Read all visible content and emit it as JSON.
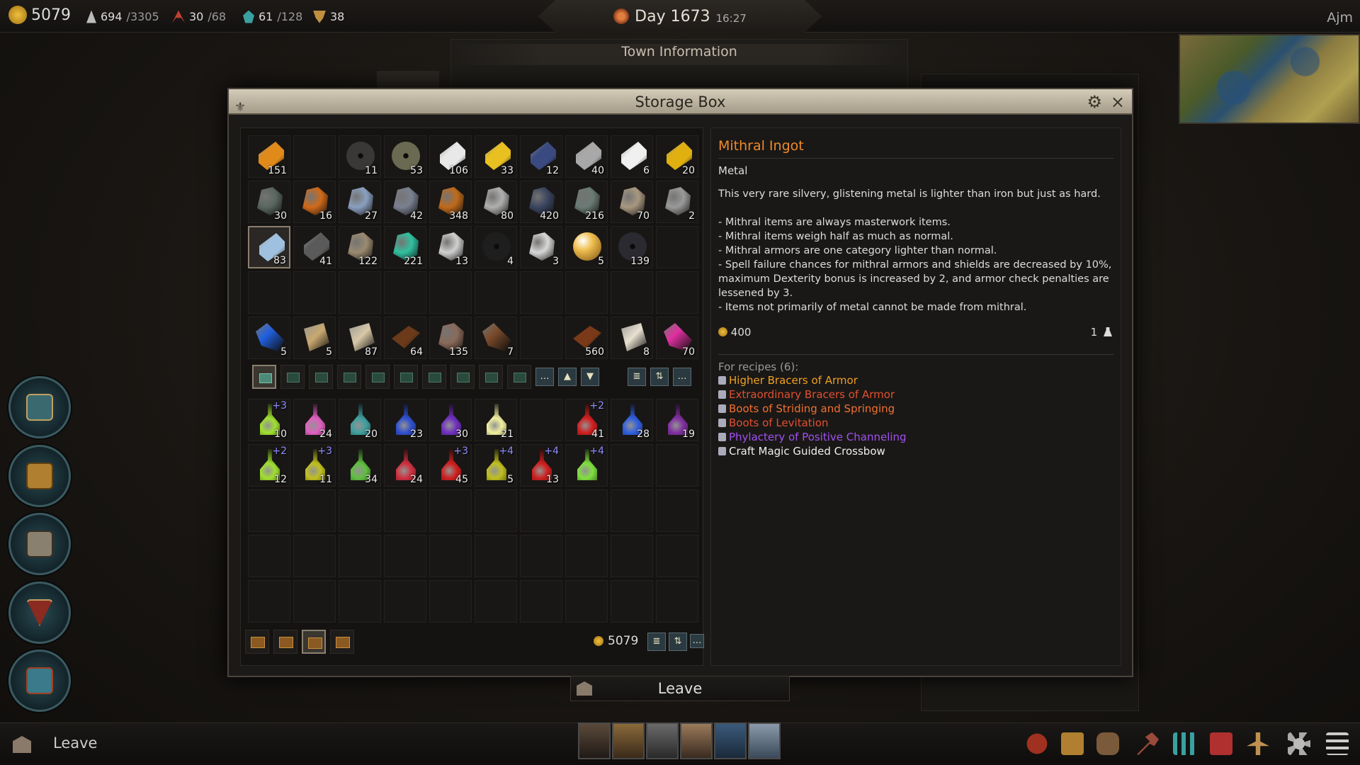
{
  "topbar": {
    "gold": "5079",
    "population": "694",
    "population_max": "/3305",
    "units": "30",
    "units_max": "/68",
    "items": "61",
    "items_max": "/128",
    "misc": "38",
    "day": "Day 1673",
    "time": "16:27",
    "player": "Ajm"
  },
  "background": {
    "town_title": "Town Information"
  },
  "window": {
    "title": "Storage Box",
    "close_icon": "×",
    "gear_icon": "⚙",
    "logo_icon": "⚜"
  },
  "materials": [
    {
      "qty": "151",
      "color": "#e08a1a",
      "shape": "ingot",
      "icon": "bronze-ingot-icon"
    },
    {
      "qty": "",
      "color": "",
      "shape": "empty",
      "icon": ""
    },
    {
      "qty": "11",
      "color": "#3a3836",
      "shape": "disc",
      "icon": "dark-disc-icon"
    },
    {
      "qty": "53",
      "color": "#6a6a52",
      "shape": "disc",
      "icon": "grinding-stone-icon"
    },
    {
      "qty": "106",
      "color": "#e8e8e8",
      "shape": "ingot",
      "icon": "silver-ingot-icon"
    },
    {
      "qty": "33",
      "color": "#e8c020",
      "shape": "ingot",
      "icon": "gold-ingot-icon"
    },
    {
      "qty": "12",
      "color": "#3a4a80",
      "shape": "ingot",
      "icon": "blue-ingot-icon"
    },
    {
      "qty": "40",
      "color": "#a8a8a8",
      "shape": "ingot",
      "icon": "iron-ingot-icon"
    },
    {
      "qty": "6",
      "color": "#f0f0f0",
      "shape": "ingot",
      "icon": "platinum-ingot-icon"
    },
    {
      "qty": "20",
      "color": "#e0b010",
      "shape": "ingot",
      "icon": "gold-bar-icon"
    },
    {
      "qty": "30",
      "color": "#5a6660",
      "shape": "ore",
      "icon": "gray-ore-icon"
    },
    {
      "qty": "16",
      "color": "#d06a1a",
      "shape": "ore",
      "icon": "fire-ore-icon"
    },
    {
      "qty": "27",
      "color": "#8aa0c0",
      "shape": "ore",
      "icon": "crystal-ore-icon"
    },
    {
      "qty": "42",
      "color": "#7a8090",
      "shape": "ore",
      "icon": "iron-ore-icon"
    },
    {
      "qty": "348",
      "color": "#c06a1a",
      "shape": "ore",
      "icon": "copper-ore-icon"
    },
    {
      "qty": "80",
      "color": "#b0b0b0",
      "shape": "ore",
      "icon": "silver-ore-icon"
    },
    {
      "qty": "420",
      "color": "#3a4560",
      "shape": "ore",
      "icon": "dark-ore-icon"
    },
    {
      "qty": "216",
      "color": "#6a7a74",
      "shape": "ore",
      "icon": "stone-ore-icon"
    },
    {
      "qty": "70",
      "color": "#a89880",
      "shape": "ore",
      "icon": "sandstone-icon"
    },
    {
      "qty": "2",
      "color": "#9a9a9a",
      "shape": "ore",
      "icon": "granite-icon"
    },
    {
      "qty": "83",
      "color": "#a0c0e0",
      "shape": "ingot",
      "icon": "mithral-ingot-icon",
      "selected": true
    },
    {
      "qty": "41",
      "color": "#5a5a5a",
      "shape": "ingot",
      "icon": "adamantine-ingot-icon"
    },
    {
      "qty": "122",
      "color": "#9a8a70",
      "shape": "ore",
      "icon": "rock-icon"
    },
    {
      "qty": "221",
      "color": "#30c0a0",
      "shape": "ore",
      "icon": "emerald-ore-icon"
    },
    {
      "qty": "13",
      "color": "#d0d0d0",
      "shape": "ore",
      "icon": "quartz-ore-icon"
    },
    {
      "qty": "4",
      "color": "#1e1e1e",
      "shape": "disc",
      "icon": "black-disc-icon"
    },
    {
      "qty": "3",
      "color": "#d8d8d8",
      "shape": "ore",
      "icon": "salt-ore-icon"
    },
    {
      "qty": "5",
      "color": "#f0c050",
      "shape": "orb",
      "icon": "gold-orb-icon"
    },
    {
      "qty": "139",
      "color": "#2a2a30",
      "shape": "disc",
      "icon": "obsidian-disc-icon"
    },
    {
      "qty": "",
      "color": "",
      "shape": "empty",
      "icon": ""
    },
    {
      "qty": "",
      "color": "",
      "shape": "empty",
      "icon": ""
    },
    {
      "qty": "",
      "color": "",
      "shape": "empty",
      "icon": ""
    },
    {
      "qty": "",
      "color": "",
      "shape": "empty",
      "icon": ""
    },
    {
      "qty": "",
      "color": "",
      "shape": "empty",
      "icon": ""
    },
    {
      "qty": "",
      "color": "",
      "shape": "empty",
      "icon": ""
    },
    {
      "qty": "",
      "color": "",
      "shape": "empty",
      "icon": ""
    },
    {
      "qty": "",
      "color": "",
      "shape": "empty",
      "icon": ""
    },
    {
      "qty": "",
      "color": "",
      "shape": "empty",
      "icon": ""
    },
    {
      "qty": "",
      "color": "",
      "shape": "empty",
      "icon": ""
    },
    {
      "qty": "",
      "color": "",
      "shape": "empty",
      "icon": ""
    },
    {
      "qty": "5",
      "color": "#2060e0",
      "shape": "cloth",
      "icon": "blue-cloth-icon"
    },
    {
      "qty": "5",
      "color": "#c8a870",
      "shape": "scroll",
      "icon": "parchment-roll-icon"
    },
    {
      "qty": "87",
      "color": "#d8c8a8",
      "shape": "scroll",
      "icon": "paper-icon"
    },
    {
      "qty": "64",
      "color": "#6a3a1a",
      "shape": "plank",
      "icon": "wood-plank-icon"
    },
    {
      "qty": "135",
      "color": "#8a6a5a",
      "shape": "ore",
      "icon": "hide-icon"
    },
    {
      "qty": "7",
      "color": "#7a4a2a",
      "shape": "cloth",
      "icon": "leather-icon"
    },
    {
      "qty": "",
      "color": "",
      "shape": "empty",
      "icon": ""
    },
    {
      "qty": "560",
      "color": "#7a3a1a",
      "shape": "plank",
      "icon": "lumber-icon"
    },
    {
      "qty": "8",
      "color": "#e8e0d0",
      "shape": "scroll",
      "icon": "scroll-icon"
    },
    {
      "qty": "70",
      "color": "#e030a0",
      "shape": "cloth",
      "icon": "silk-icon"
    }
  ],
  "tab_bar": {
    "more": "…",
    "up": "▲",
    "down": "▼",
    "stack": "≣",
    "sort": "⇅",
    "options": "…"
  },
  "potions": [
    {
      "qty": "10",
      "plus": "+3",
      "color": "#a0e030"
    },
    {
      "qty": "24",
      "plus": "",
      "color": "#e060c0"
    },
    {
      "qty": "20",
      "plus": "",
      "color": "#40a0a0"
    },
    {
      "qty": "23",
      "plus": "",
      "color": "#3050d0"
    },
    {
      "qty": "30",
      "plus": "",
      "color": "#7030c0"
    },
    {
      "qty": "21",
      "plus": "",
      "color": "#f0f0a0"
    },
    {
      "qty": "",
      "plus": "",
      "color": ""
    },
    {
      "qty": "41",
      "plus": "+2",
      "color": "#d02020"
    },
    {
      "qty": "28",
      "plus": "",
      "color": "#3060e0"
    },
    {
      "qty": "19",
      "plus": "",
      "color": "#8030a0"
    },
    {
      "qty": "12",
      "plus": "+2",
      "color": "#a0e030"
    },
    {
      "qty": "11",
      "plus": "+3",
      "color": "#c0c020"
    },
    {
      "qty": "34",
      "plus": "",
      "color": "#60c040"
    },
    {
      "qty": "24",
      "plus": "",
      "color": "#d03040"
    },
    {
      "qty": "45",
      "plus": "+3",
      "color": "#d02020"
    },
    {
      "qty": "5",
      "plus": "+4",
      "color": "#c0c020"
    },
    {
      "qty": "13",
      "plus": "+4",
      "color": "#d02020"
    },
    {
      "qty": "",
      "plus": "+4",
      "color": "#80e040"
    },
    {
      "qty": "",
      "plus": "",
      "color": ""
    },
    {
      "qty": "",
      "plus": "",
      "color": ""
    }
  ],
  "footer": {
    "gold": "5079"
  },
  "detail": {
    "name": "Mithral Ingot",
    "type": "Metal",
    "desc_intro": "This very rare silvery, glistening metal is lighter than iron but just as hard.",
    "bullets": [
      "- Mithral items are always masterwork items.",
      "- Mithral items weigh half as much as normal.",
      "- Mithral armors are one category lighter than normal.",
      "- Spell failure chances for mithral armors and shields are decreased by 10%, maximum Dexterity bonus is increased by 2, and armor check penalties are lessened by 3.",
      "- Items not primarily of metal cannot be made from mithral."
    ],
    "price": "400",
    "weight": "1",
    "recipes_title": "For recipes (6):",
    "recipes": [
      {
        "name": "Higher Bracers of Armor",
        "color": "#f0a020"
      },
      {
        "name": "Extraordinary Bracers of Armor",
        "color": "#e05030"
      },
      {
        "name": "Boots of Striding and Springing",
        "color": "#f07030"
      },
      {
        "name": "Boots of Levitation",
        "color": "#e05030"
      },
      {
        "name": "Phylactery of Positive Channeling",
        "color": "#a050f0"
      },
      {
        "name": "Craft Magic Guided Crossbow",
        "color": "#eeeeee"
      }
    ]
  },
  "leave_button": "Leave",
  "bottombar": {
    "leave": "Leave"
  }
}
